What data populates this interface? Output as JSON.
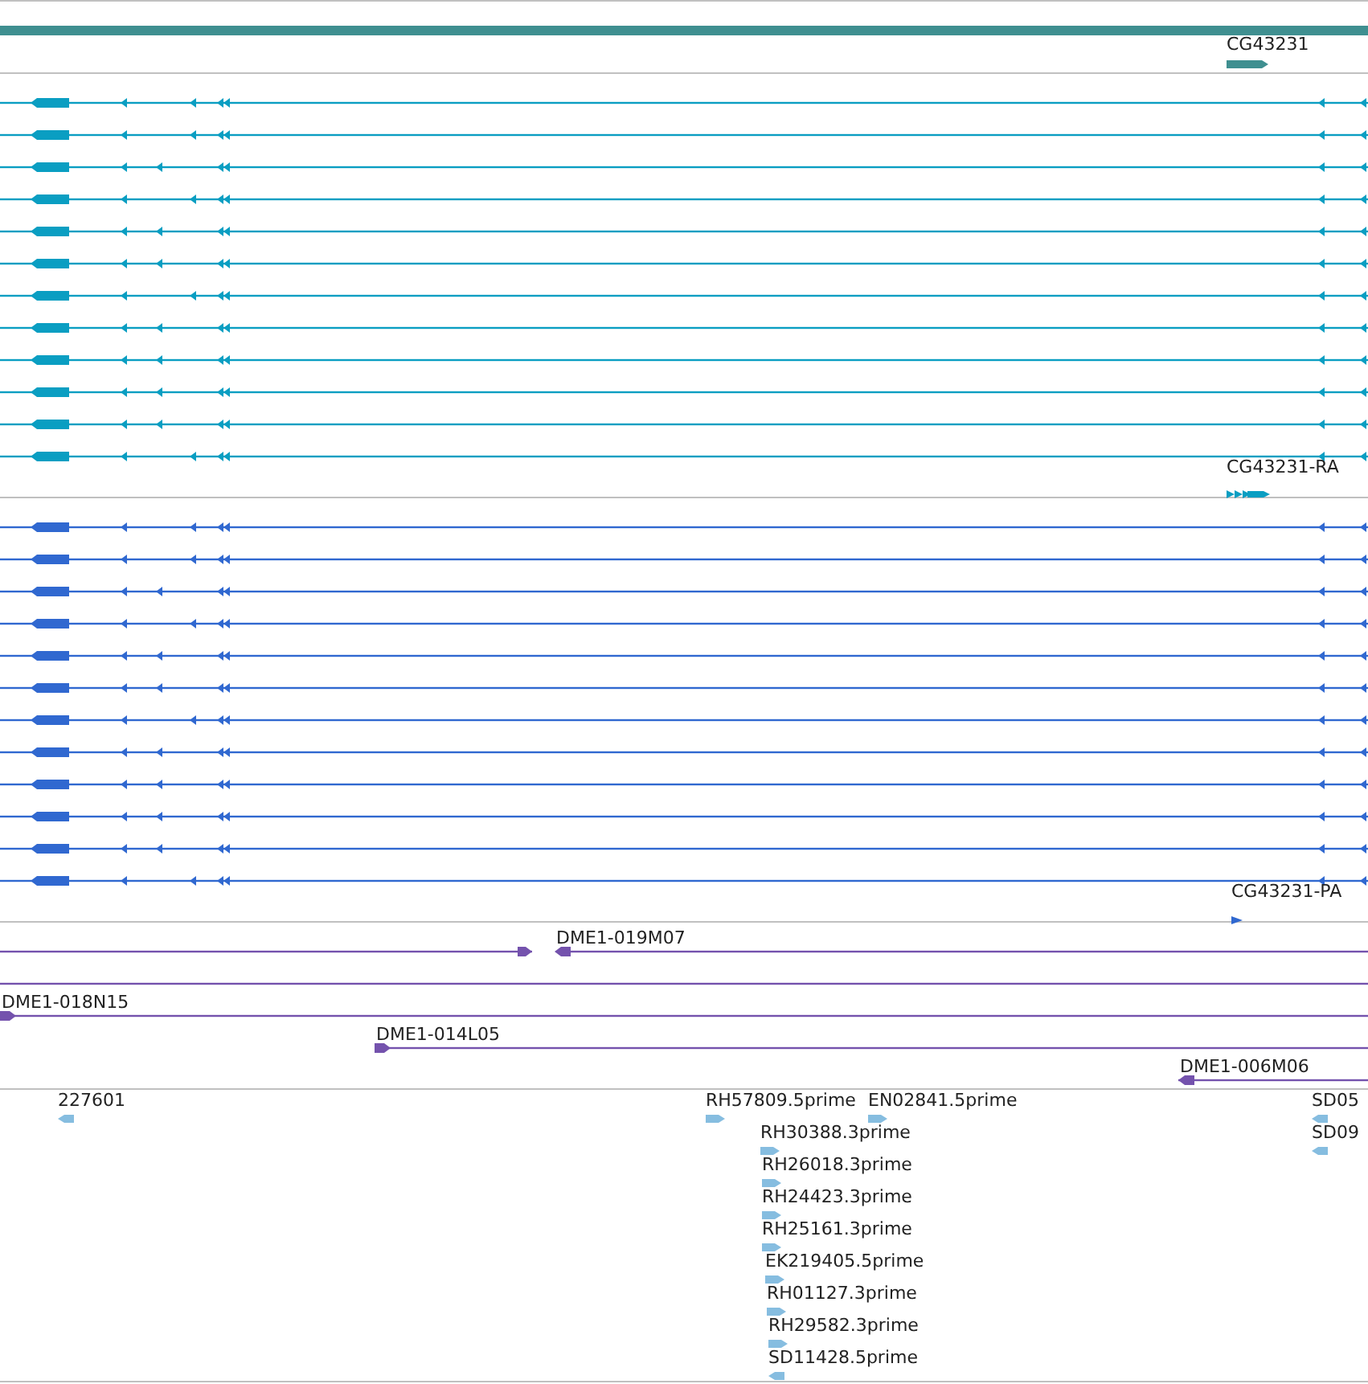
{
  "tracks": [
    {
      "kind": "gene",
      "features": [
        {
          "label": "CG43231",
          "reverse": false
        }
      ]
    },
    {
      "kind": "transcript",
      "rows": [
        {
          "kind": "a"
        },
        {
          "kind": "a"
        },
        {
          "kind": "b"
        },
        {
          "kind": "a"
        },
        {
          "kind": "b"
        },
        {
          "kind": "b"
        },
        {
          "kind": "a"
        },
        {
          "kind": "b"
        },
        {
          "kind": "b"
        },
        {
          "kind": "b"
        },
        {
          "kind": "b"
        },
        {
          "kind": "a"
        }
      ],
      "feature": {
        "label": "CG43231-RA",
        "reverse": false
      }
    },
    {
      "kind": "protein",
      "rows": [
        {
          "kind": "a"
        },
        {
          "kind": "a"
        },
        {
          "kind": "b"
        },
        {
          "kind": "a"
        },
        {
          "kind": "b"
        },
        {
          "kind": "b"
        },
        {
          "kind": "a"
        },
        {
          "kind": "b"
        },
        {
          "kind": "b"
        },
        {
          "kind": "b"
        },
        {
          "kind": "b"
        },
        {
          "kind": "a"
        }
      ],
      "feature": {
        "label": "CG43231-PA",
        "reverse": false
      }
    },
    {
      "kind": "clone",
      "rows": [
        {
          "kind": "gap",
          "label": "DME1-019M07"
        },
        {
          "kind": "span"
        },
        {
          "kind": "start",
          "label": "DME1-018N15"
        },
        {
          "kind": "start",
          "label": "DME1-014L05"
        },
        {
          "kind": "end",
          "label": "DME1-006M06"
        }
      ]
    },
    {
      "kind": "est",
      "features": [
        {
          "label": "227601",
          "reverse": true
        },
        {
          "label": "RH57809.5prime",
          "reverse": false
        },
        {
          "label": "EN02841.5prime",
          "reverse": false
        },
        {
          "label": "SD05",
          "reverse": true
        },
        {
          "label": "RH30388.3prime",
          "reverse": false
        },
        {
          "label": "SD09",
          "reverse": true
        },
        {
          "label": "RH26018.3prime",
          "reverse": false
        },
        {
          "label": "RH24423.3prime",
          "reverse": false
        },
        {
          "label": "RH25161.3prime",
          "reverse": false
        },
        {
          "label": "EK219405.5prime",
          "reverse": false
        },
        {
          "label": "RH01127.3prime",
          "reverse": false
        },
        {
          "label": "RH29582.3prime",
          "reverse": false
        },
        {
          "label": "SD11428.5prime",
          "reverse": true
        }
      ]
    }
  ]
}
